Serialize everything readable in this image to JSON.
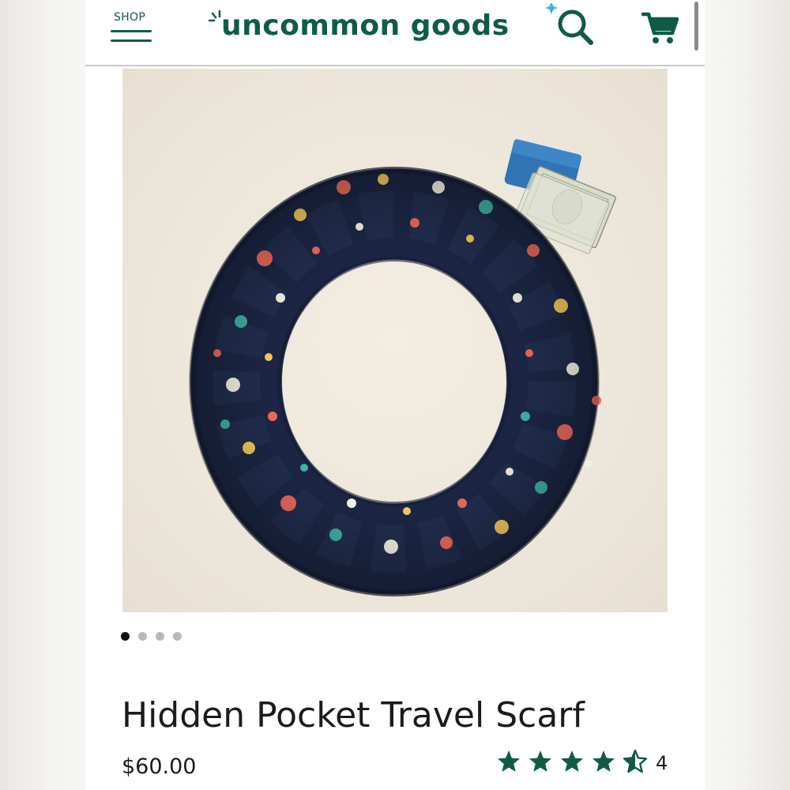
{
  "header": {
    "shop_label": "SHOP",
    "logo_text": "uncommon goods",
    "menu_icon": "hamburger-menu-icon",
    "search_icon": "search-icon",
    "cart_icon": "shopping-cart-icon"
  },
  "colors": {
    "brand_green": "#0f5c46",
    "accent_blue": "#3ab0e2",
    "star_green": "#0f5c46"
  },
  "product": {
    "image_icon": "product-photo",
    "image_count": 4,
    "active_image": 1,
    "title": "Hidden Pocket Travel Scarf",
    "price": "$60.00",
    "rating": 4.5,
    "rating_max": 5,
    "review_count": "4"
  }
}
